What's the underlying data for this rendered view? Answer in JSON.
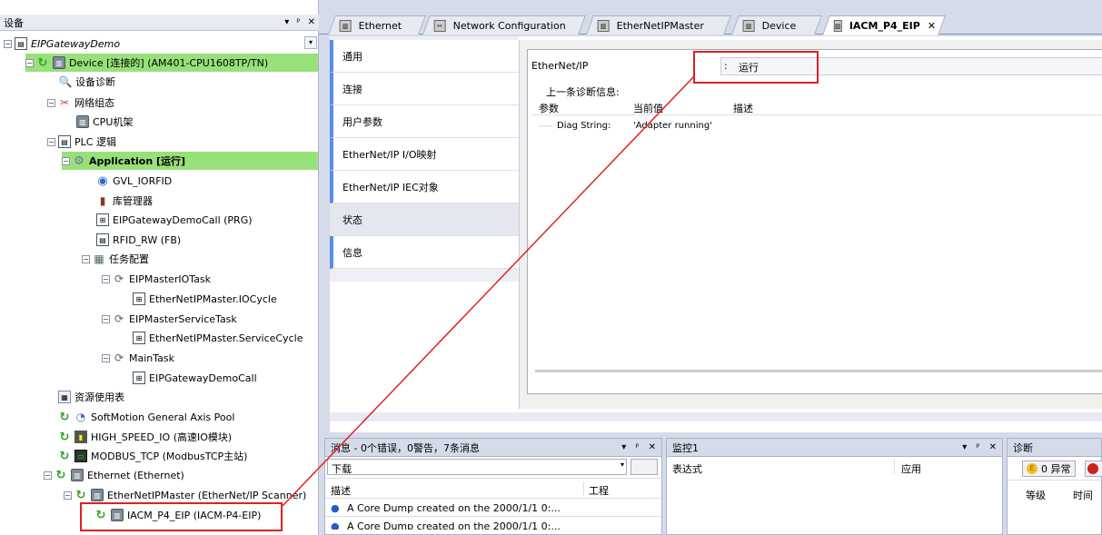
{
  "tree_panel": {
    "title": "设备",
    "controls": [
      "▾",
      "ᵖ",
      "✕"
    ]
  },
  "tree": [
    {
      "id": "root",
      "label": "EIPGatewayDemo",
      "italic": true
    },
    {
      "id": "device",
      "label": "Device [连接的] (AM401-CPU1608TP/TN)"
    },
    {
      "id": "diag",
      "label": "设备诊断"
    },
    {
      "id": "netcfg",
      "label": "网络组态"
    },
    {
      "id": "cpurack",
      "label": "CPU机架"
    },
    {
      "id": "plclogic",
      "label": "PLC 逻辑"
    },
    {
      "id": "app",
      "label": "Application [运行]"
    },
    {
      "id": "gvl",
      "label": "GVL_IORFID"
    },
    {
      "id": "lib",
      "label": "库管理器"
    },
    {
      "id": "prg",
      "label": "EIPGatewayDemoCall (PRG)"
    },
    {
      "id": "fb",
      "label": "RFID_RW (FB)"
    },
    {
      "id": "taskcfg",
      "label": "任务配置"
    },
    {
      "id": "iotask",
      "label": "EIPMasterIOTask"
    },
    {
      "id": "iocycle",
      "label": "EtherNetIPMaster.IOCycle"
    },
    {
      "id": "svctask",
      "label": "EIPMasterServiceTask"
    },
    {
      "id": "svccycle",
      "label": "EtherNetIPMaster.ServiceCycle"
    },
    {
      "id": "maintask",
      "label": "MainTask"
    },
    {
      "id": "democall",
      "label": "EIPGatewayDemoCall"
    },
    {
      "id": "resusage",
      "label": "资源使用表"
    },
    {
      "id": "softmotion",
      "label": "SoftMotion General Axis Pool"
    },
    {
      "id": "hsio",
      "label": "HIGH_SPEED_IO (高速IO模块)"
    },
    {
      "id": "modbus",
      "label": "MODBUS_TCP (ModbusTCP主站)"
    },
    {
      "id": "ethernet",
      "label": "Ethernet (Ethernet)"
    },
    {
      "id": "eipmaster",
      "label": "EtherNetIPMaster (EtherNet/IP Scanner)"
    },
    {
      "id": "iacm",
      "label": "IACM_P4_EIP (IACM-P4-EIP)"
    }
  ],
  "tabs": [
    "Ethernet",
    "Network Configuration",
    "EtherNetIPMaster",
    "Device",
    "IACM_P4_EIP"
  ],
  "tab_close": "✕",
  "side_tabs": [
    "通用",
    "连接",
    "用户参数",
    "EtherNet/IP I/O映射",
    "EtherNet/IP IEC对象",
    "状态",
    "信息"
  ],
  "status": {
    "label": "EtherNet/IP",
    "sep": ":",
    "value": "运行",
    "diag_title": "上一条诊断信息:",
    "columns": [
      "参数",
      "当前值",
      "描述"
    ],
    "row": {
      "param": "Diag String:",
      "value": "'Adapter running'"
    }
  },
  "messages": {
    "title": "消息 - 0个错误，0警告，7条消息",
    "filter": "下载",
    "columns": [
      "描述",
      "工程"
    ],
    "rows": [
      "A Core Dump created on the 2000/1/1 0:...",
      "A Core Dump created on the 2000/1/1 0:..."
    ]
  },
  "watch": {
    "title": "监控1",
    "columns": [
      "表达式",
      "应用"
    ]
  },
  "diagnosis": {
    "title": "诊断",
    "exceptions": "0 异常",
    "columns": [
      "等级",
      "时间"
    ]
  },
  "panel_controls": [
    "▾",
    "ᵖ",
    "✕"
  ]
}
